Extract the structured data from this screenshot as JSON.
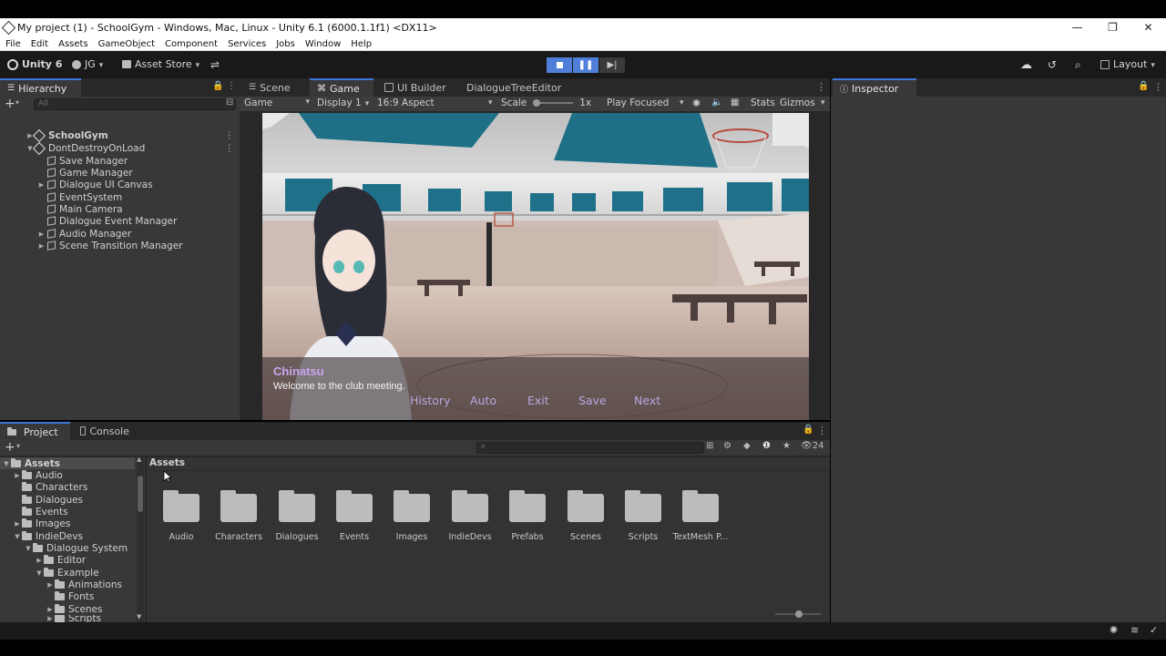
{
  "window": {
    "title": "My project (1) - SchoolGym - Windows, Mac, Linux - Unity 6.1 (6000.1.1f1) <DX11>",
    "controls": [
      "—",
      "❐",
      "✕"
    ]
  },
  "menu": [
    "File",
    "Edit",
    "Assets",
    "GameObject",
    "Component",
    "Services",
    "Jobs",
    "Window",
    "Help"
  ],
  "toolbar": {
    "brand": "Unity 6",
    "account": "JG",
    "asset_store": "Asset Store",
    "layout": "Layout"
  },
  "hierarchy": {
    "tab": "Hierarchy",
    "search_placeholder": "All",
    "items": [
      {
        "label": "SchoolGym",
        "bold": true
      },
      {
        "label": "DontDestroyOnLoad",
        "bold": false
      },
      {
        "label": "Save Manager"
      },
      {
        "label": "Game Manager"
      },
      {
        "label": "Dialogue UI Canvas"
      },
      {
        "label": "EventSystem"
      },
      {
        "label": "Main Camera"
      },
      {
        "label": "Dialogue Event Manager"
      },
      {
        "label": "Audio Manager"
      },
      {
        "label": "Scene Transition Manager"
      }
    ]
  },
  "center_tabs": [
    "Scene",
    "Game",
    "UI Builder",
    "DialogueTreeEditor"
  ],
  "game_toolbar": {
    "mode": "Game",
    "display": "Display 1",
    "aspect": "16:9 Aspect",
    "scale_label": "Scale",
    "scale_value": "1x",
    "play_mode": "Play Focused",
    "stats": "Stats",
    "gizmos": "Gizmos"
  },
  "dialogue": {
    "speaker": "Chinatsu",
    "line": "Welcome to the club meeting.",
    "buttons": [
      "History",
      "Auto",
      "Exit",
      "Save",
      "Next"
    ]
  },
  "inspector": {
    "tab": "Inspector"
  },
  "bottom_tabs": [
    "Project",
    "Console"
  ],
  "project": {
    "badge_count": "24",
    "breadcrumb": "Assets",
    "tree": [
      {
        "label": "Assets",
        "depth": 0
      },
      {
        "label": "Audio",
        "depth": 1
      },
      {
        "label": "Characters",
        "depth": 1
      },
      {
        "label": "Dialogues",
        "depth": 1
      },
      {
        "label": "Events",
        "depth": 1
      },
      {
        "label": "Images",
        "depth": 1
      },
      {
        "label": "IndieDevs",
        "depth": 1
      },
      {
        "label": "Dialogue System",
        "depth": 2
      },
      {
        "label": "Editor",
        "depth": 3
      },
      {
        "label": "Example",
        "depth": 3
      },
      {
        "label": "Animations",
        "depth": 4
      },
      {
        "label": "Fonts",
        "depth": 4
      },
      {
        "label": "Scenes",
        "depth": 4
      },
      {
        "label": "Scripts",
        "depth": 4
      }
    ],
    "folders": [
      "Audio",
      "Characters",
      "Dialogues",
      "Events",
      "Images",
      "IndieDevs",
      "Prefabs",
      "Scenes",
      "Scripts",
      "TextMesh P..."
    ]
  },
  "colors": {
    "accent": "#3c78d8",
    "play_active": "#4f7fd8",
    "dialogue_name": "#c7a6ef",
    "dialogue_button": "#b7a6e0"
  }
}
